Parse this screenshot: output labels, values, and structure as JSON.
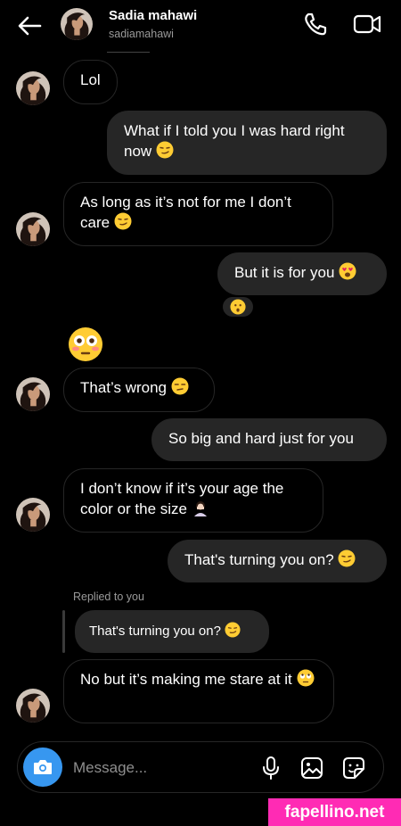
{
  "header": {
    "name": "Sadia mahawi",
    "username": "sadiamahawi"
  },
  "messages": {
    "m1": "Lol",
    "m2": "What if I told you I was hard right now",
    "m3": "As long as it’s not for me I don’t care",
    "m4": "But it is for you",
    "m5": "That’s wrong",
    "m6": "So big and hard just for you",
    "m7": "I don’t know if it’s your age the color or the size",
    "m8": "That's turning you on?",
    "m9": "No but it’s making me stare at it"
  },
  "reply": {
    "label": "Replied to you",
    "quoted": "That's turning you on?"
  },
  "composer": {
    "placeholder": "Message..."
  },
  "watermark": "fapellino.net",
  "colors": {
    "background": "#000000",
    "outgoing_bubble": "#262626",
    "camera_button": "#3797f0",
    "watermark": "#ff2bb4"
  },
  "icons": [
    "back-arrow-icon",
    "phone-icon",
    "video-icon",
    "camera-icon",
    "mic-icon",
    "gallery-icon",
    "sticker-icon"
  ]
}
